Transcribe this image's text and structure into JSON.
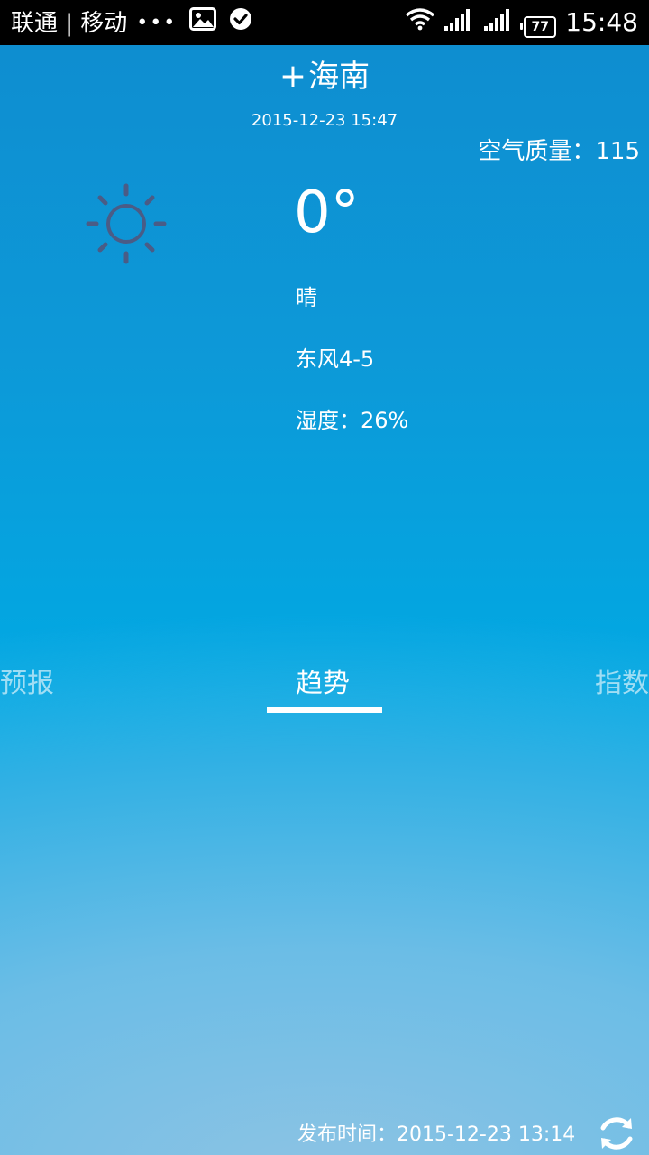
{
  "status_bar": {
    "carrier": "联通 | 移动",
    "dots": "•••",
    "left_icons": [
      "image-icon",
      "check-circle-icon"
    ],
    "right_icons": [
      "wifi-icon",
      "signal-icon",
      "signal-icon",
      "battery-icon"
    ],
    "battery": "77",
    "time": "15:48"
  },
  "header": {
    "plus": "+",
    "city": "海南",
    "update_time": "2015-12-23  15:47",
    "aqi": "空气质量：115"
  },
  "current": {
    "icon": "sun-icon",
    "temperature": "0°",
    "condition": "晴",
    "wind": "东风4-5",
    "humidity": "湿度：26%"
  },
  "tabs": {
    "items": [
      {
        "label": "预报",
        "active": false
      },
      {
        "label": "趋势",
        "active": true
      },
      {
        "label": "指数",
        "active": false
      }
    ]
  },
  "footer": {
    "publish_time": "发布时间：2015-12-23 13:14",
    "refresh_icon": "refresh-icon"
  },
  "colors": {
    "sky_top": "#0e8ccf",
    "sky_mid": "#00b0e6",
    "sky_bottom": "#86c0e2",
    "sun_icon": "#4a5c86"
  }
}
